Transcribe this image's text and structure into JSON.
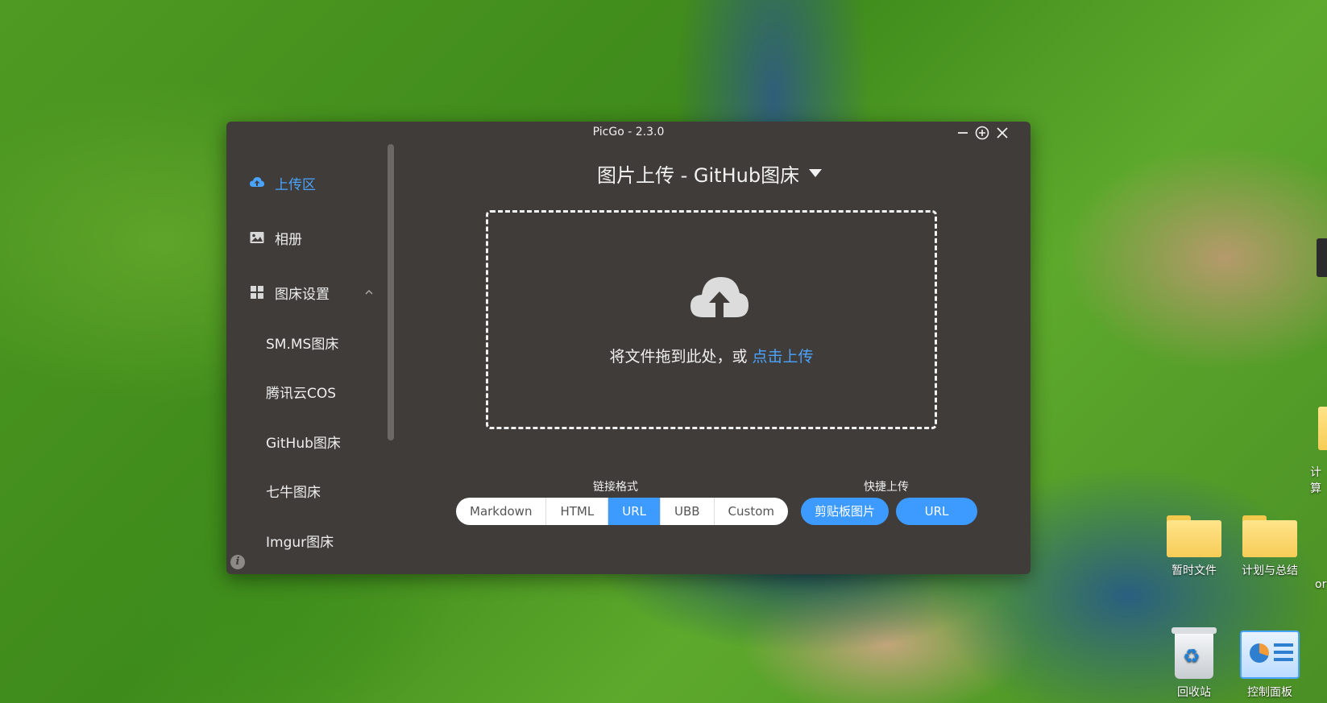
{
  "window": {
    "title": "PicGo - 2.3.0",
    "controls": {
      "minimize": "minimize-icon",
      "pin": "pin-icon",
      "close": "close-icon"
    }
  },
  "sidebar": {
    "upload": {
      "label": "上传区",
      "icon": "cloud-upload-icon"
    },
    "album": {
      "label": "相册",
      "icon": "image-icon"
    },
    "picbed_settings": {
      "label": "图床设置",
      "icon": "grid-icon"
    },
    "picbeds": [
      "SM.MS图床",
      "腾讯云COS",
      "GitHub图床",
      "七牛图床",
      "Imgur图床"
    ]
  },
  "main": {
    "title": "图片上传 - GitHub图床",
    "dropzone": {
      "text": "将文件拖到此处，或 ",
      "link": "点击上传"
    },
    "link_format": {
      "label": "链接格式",
      "options": [
        "Markdown",
        "HTML",
        "URL",
        "UBB",
        "Custom"
      ],
      "selected": "URL"
    },
    "quick_upload": {
      "label": "快捷上传",
      "clipboard": "剪贴板图片",
      "url": "URL"
    }
  },
  "desktop": {
    "icons": [
      {
        "label": "暂时文件",
        "icon": "folder-icon"
      },
      {
        "label": "计划与总结",
        "icon": "folder-icon"
      },
      {
        "label": "回收站",
        "icon": "recycle-bin-icon"
      },
      {
        "label": "控制面板",
        "icon": "control-panel-icon"
      }
    ],
    "partial_labels": [
      "计算",
      "or"
    ]
  },
  "colors": {
    "accent": "#3d9bff",
    "window_bg": "#3f3c39"
  }
}
